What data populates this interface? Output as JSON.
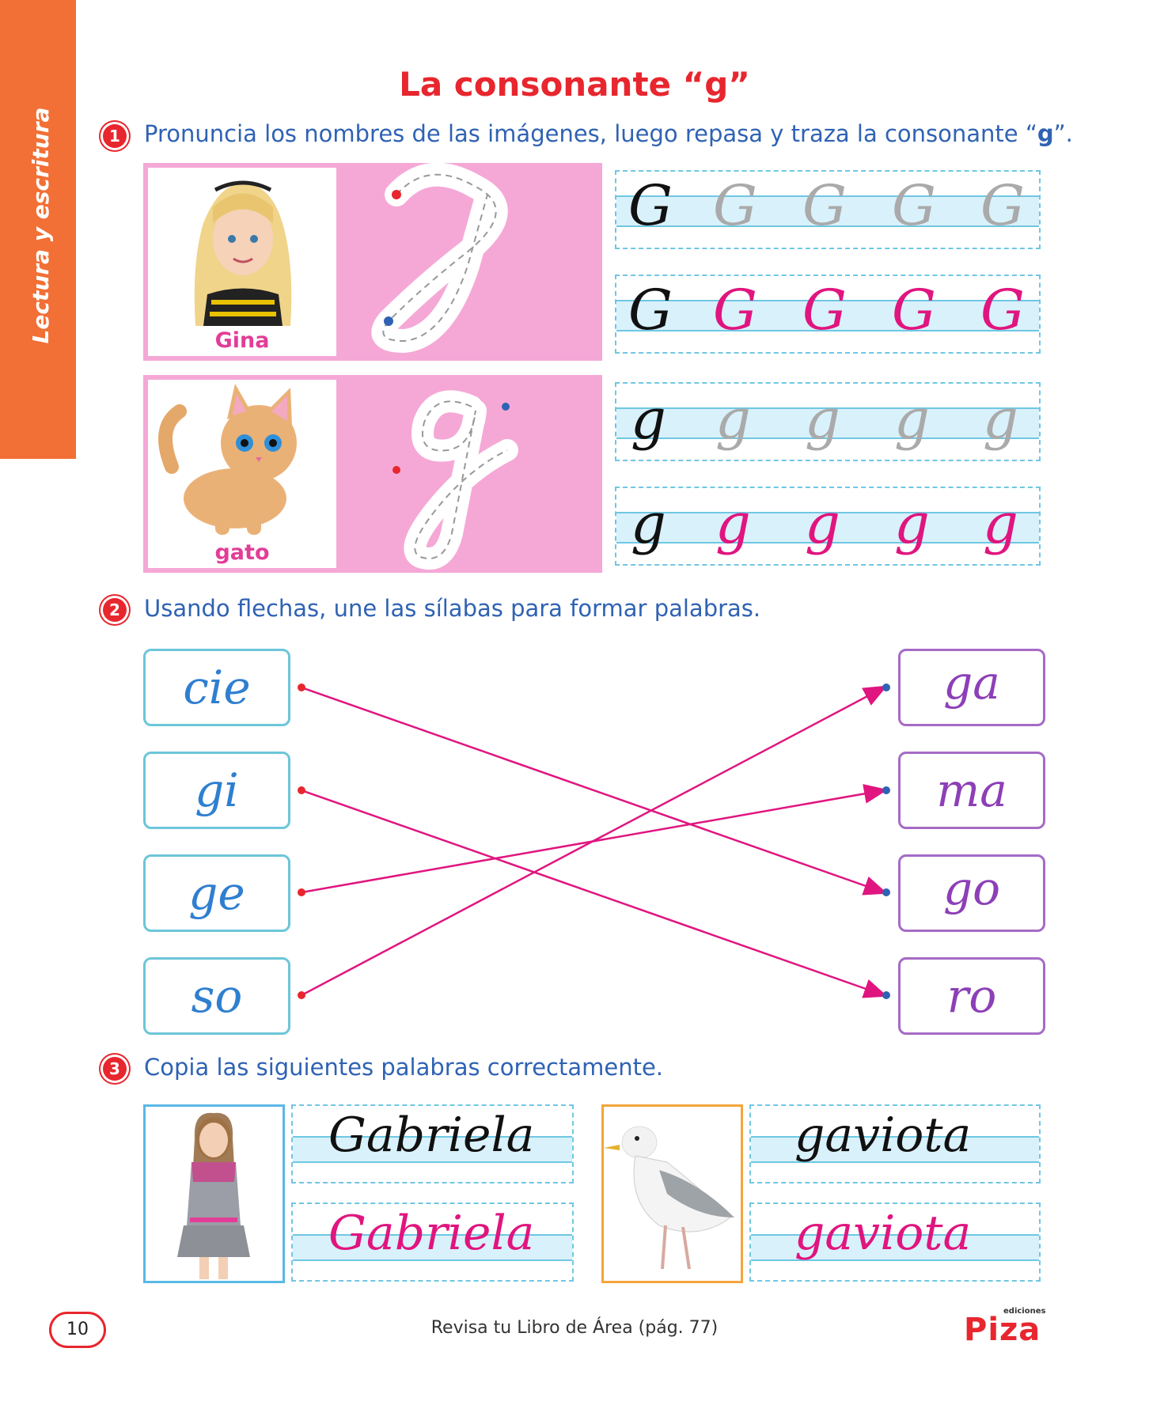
{
  "side_tab": {
    "label": "Lectura y escritura"
  },
  "title": "La consonante “g”",
  "exercise1": {
    "number": "1",
    "instruction_pre": "Pronuncia los nombres de las imágenes, luego repasa y traza la consonante “",
    "instruction_bold": "g",
    "instruction_post": "”.",
    "cards": [
      {
        "label": "Gina",
        "letter": "G"
      },
      {
        "label": "gato",
        "letter": "g"
      }
    ]
  },
  "exercise2": {
    "number": "2",
    "instruction": "Usando flechas, une las sílabas para formar palabras.",
    "left": [
      "cie",
      "gi",
      "ge",
      "so"
    ],
    "right": [
      "ga",
      "ma",
      "go",
      "ro"
    ]
  },
  "exercise3": {
    "number": "3",
    "instruction": "Copia las siguientes palabras correctamente.",
    "words": [
      "Gabriela",
      "gaviota"
    ]
  },
  "footer": {
    "page": "10",
    "text": "Revisa tu Libro de Área (pág. 77)",
    "logo": "Piza",
    "logo_small": "ediciones"
  },
  "colors": {
    "accent": "#e8262e",
    "pink": "#f5a8d6",
    "magenta": "#e0157f",
    "blue": "#2f62b3",
    "orange": "#f26f35"
  }
}
